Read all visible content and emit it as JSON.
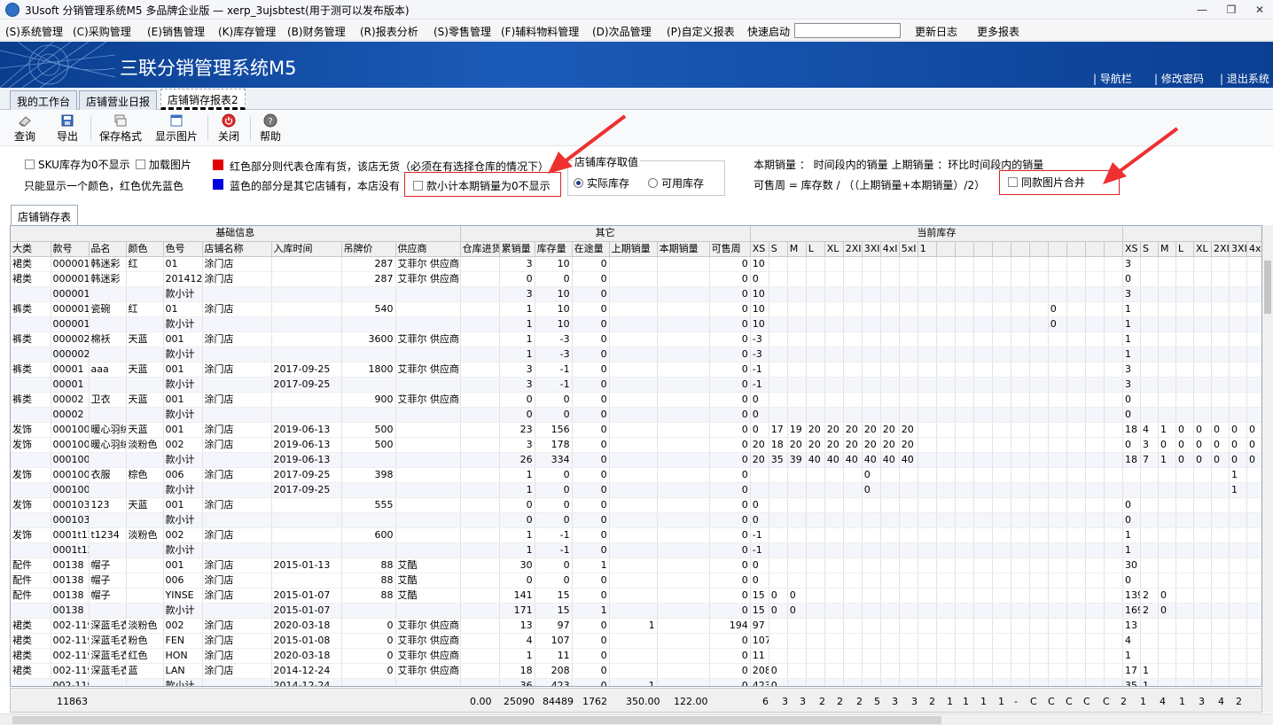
{
  "window": {
    "title": "3Usoft 分销管理系统M5 多品牌企业版 — xerp_3ujsbtest(用于测可以发布版本)"
  },
  "menu": {
    "items": [
      "(S)系统管理",
      "(C)采购管理",
      "(E)销售管理",
      "(K)库存管理",
      "(B)财务管理",
      "(R)报表分析",
      "(S)零售管理",
      "(F)辅料物料管理",
      "(D)次品管理",
      "(P)自定义报表"
    ],
    "quick_start": "快速启动",
    "search_value": "",
    "update_log": "更新日志",
    "more_reports": "更多报表"
  },
  "banner": {
    "title": "三联分销管理系统M5",
    "links": [
      "导航栏",
      "修改密码",
      "退出系统"
    ]
  },
  "tabs": [
    {
      "label": "我的工作台"
    },
    {
      "label": "店铺营业日报"
    },
    {
      "label": "店铺销存报表2"
    }
  ],
  "toolbar": {
    "query": "查询",
    "export": "导出",
    "save_format": "保存格式",
    "show_image": "显示图片",
    "close": "关闭",
    "help": "帮助"
  },
  "filters": {
    "sku_zero_hide": "SKU库存为0不显示",
    "load_image": "加载图片",
    "only_one_color": "只能显示一个颜色，红色优先蓝色",
    "red_note": "红色部分则代表仓库有货，该店无货（必须在有选择仓库的情况下）",
    "blue_note": "蓝色的部分是其它店铺有，本店没有",
    "subtotal_zero_hide": "款小计本期销量为0不显示",
    "stock_group": "店铺库存取值",
    "actual_stock": "实际库存",
    "available_stock": "可用库存",
    "sales_def": "本期销量 ： 时间段内的销量   上期销量 ：环比时间段内的销量",
    "weeks_def": "可售周 = 库存数 / （（上期销量+本期销量）/2）",
    "merge_same_image": "同款图片合并",
    "red_color": "#e00000",
    "blue_color": "#0000e0"
  },
  "subtab": "店铺销存表",
  "grid": {
    "groups": [
      {
        "label": "基础信息",
        "span": 9
      },
      {
        "label": "其它",
        "span": 7
      },
      {
        "label": "当前库存",
        "span": 20
      },
      {
        "label": "",
        "span": 8
      }
    ],
    "headers": [
      "大类",
      "款号",
      "品名",
      "颜色",
      "色号",
      "店铺名称",
      "入库时间",
      "吊牌价",
      "供应商",
      "仓库进货",
      "累销量",
      "库存量",
      "在途量",
      "上期销量",
      "本期销量",
      "可售周",
      "XS",
      "S",
      "M",
      "L",
      "XL",
      "2XI",
      "3XI",
      "4xI",
      "5xI",
      "1",
      "",
      "",
      "",
      "",
      "",
      "",
      "",
      "",
      "",
      "",
      "XS",
      "S",
      "M",
      "L",
      "XL",
      "2XI",
      "3XI",
      "4x1"
    ],
    "rows": [
      [
        "裙类",
        "000001",
        "韩迷彩",
        "红",
        "01",
        "涂门店",
        "",
        "287",
        "艾菲尔 供应商",
        "",
        "3",
        "10",
        "0",
        "",
        "",
        "0",
        "10",
        "",
        "",
        "",
        "",
        "",
        "",
        "",
        "",
        "",
        "",
        "",
        "",
        "",
        "",
        "",
        "",
        "",
        "",
        "",
        "3",
        "",
        "",
        "",
        "",
        "",
        "",
        ""
      ],
      [
        "裙类",
        "000001",
        "韩迷彩",
        "",
        "201412",
        "涂门店",
        "",
        "287",
        "艾菲尔 供应商",
        "",
        "0",
        "0",
        "0",
        "",
        "",
        "0",
        "0",
        "",
        "",
        "",
        "",
        "",
        "",
        "",
        "",
        "",
        "",
        "",
        "",
        "",
        "",
        "",
        "",
        "",
        "",
        "",
        "0",
        "",
        "",
        "",
        "",
        "",
        "",
        ""
      ],
      [
        "",
        "000001",
        "",
        "",
        "款小计",
        "",
        "",
        "",
        "",
        "",
        "3",
        "10",
        "0",
        "",
        "",
        "0",
        "10",
        "",
        "",
        "",
        "",
        "",
        "",
        "",
        "",
        "",
        "",
        "",
        "",
        "",
        "",
        "",
        "",
        "",
        "",
        "",
        "3",
        "",
        "",
        "",
        "",
        "",
        "",
        ""
      ],
      [
        "裤类",
        "000001",
        "瓷碗",
        "红",
        "01",
        "涂门店",
        "",
        "540",
        "",
        "",
        "1",
        "10",
        "0",
        "",
        "",
        "0",
        "10",
        "",
        "",
        "",
        "",
        "",
        "",
        "",
        "",
        "",
        "",
        "",
        "",
        "",
        "",
        "",
        "0",
        "",
        "",
        "",
        "1",
        "",
        "",
        "",
        "",
        "",
        "",
        ""
      ],
      [
        "",
        "000001",
        "",
        "",
        "款小计",
        "",
        "",
        "",
        "",
        "",
        "1",
        "10",
        "0",
        "",
        "",
        "0",
        "10",
        "",
        "",
        "",
        "",
        "",
        "",
        "",
        "",
        "",
        "",
        "",
        "",
        "",
        "",
        "",
        "0",
        "",
        "",
        "",
        "1",
        "",
        "",
        "",
        "",
        "",
        "",
        ""
      ],
      [
        "裤类",
        "000002",
        "棉袄",
        "天蓝",
        "001",
        "涂门店",
        "",
        "3600",
        "艾菲尔 供应商",
        "",
        "1",
        "-3",
        "0",
        "",
        "",
        "0",
        "-3",
        "",
        "",
        "",
        "",
        "",
        "",
        "",
        "",
        "",
        "",
        "",
        "",
        "",
        "",
        "",
        "",
        "",
        "",
        "",
        "1",
        "",
        "",
        "",
        "",
        "",
        "",
        ""
      ],
      [
        "",
        "000002",
        "",
        "",
        "款小计",
        "",
        "",
        "",
        "",
        "",
        "1",
        "-3",
        "0",
        "",
        "",
        "0",
        "-3",
        "",
        "",
        "",
        "",
        "",
        "",
        "",
        "",
        "",
        "",
        "",
        "",
        "",
        "",
        "",
        "",
        "",
        "",
        "",
        "1",
        "",
        "",
        "",
        "",
        "",
        "",
        ""
      ],
      [
        "裤类",
        "00001",
        "aaa",
        "天蓝",
        "001",
        "涂门店",
        "2017-09-25",
        "1800",
        "艾菲尔 供应商",
        "",
        "3",
        "-1",
        "0",
        "",
        "",
        "0",
        "-1",
        "",
        "",
        "",
        "",
        "",
        "",
        "",
        "",
        "",
        "",
        "",
        "",
        "",
        "",
        "",
        "",
        "",
        "",
        "",
        "3",
        "",
        "",
        "",
        "",
        "",
        "",
        ""
      ],
      [
        "",
        "00001",
        "",
        "",
        "款小计",
        "",
        "2017-09-25",
        "",
        "",
        "",
        "3",
        "-1",
        "0",
        "",
        "",
        "0",
        "-1",
        "",
        "",
        "",
        "",
        "",
        "",
        "",
        "",
        "",
        "",
        "",
        "",
        "",
        "",
        "",
        "",
        "",
        "",
        "",
        "3",
        "",
        "",
        "",
        "",
        "",
        "",
        ""
      ],
      [
        "裤类",
        "00002",
        "卫衣",
        "天蓝",
        "001",
        "涂门店",
        "",
        "900",
        "艾菲尔 供应商",
        "",
        "0",
        "0",
        "0",
        "",
        "",
        "0",
        "0",
        "",
        "",
        "",
        "",
        "",
        "",
        "",
        "",
        "",
        "",
        "",
        "",
        "",
        "",
        "",
        "",
        "",
        "",
        "",
        "0",
        "",
        "",
        "",
        "",
        "",
        "",
        ""
      ],
      [
        "",
        "00002",
        "",
        "",
        "款小计",
        "",
        "",
        "",
        "",
        "",
        "0",
        "0",
        "0",
        "",
        "",
        "0",
        "0",
        "",
        "",
        "",
        "",
        "",
        "",
        "",
        "",
        "",
        "",
        "",
        "",
        "",
        "",
        "",
        "",
        "",
        "",
        "",
        "0",
        "",
        "",
        "",
        "",
        "",
        "",
        ""
      ],
      [
        "发饰",
        "0001000",
        "暖心羽绒",
        "天蓝",
        "001",
        "涂门店",
        "2019-06-13",
        "500",
        "",
        "",
        "23",
        "156",
        "0",
        "",
        "",
        "0",
        "0",
        "17",
        "19",
        "20",
        "20",
        "20",
        "20",
        "20",
        "20",
        "",
        "",
        "",
        "",
        "",
        "",
        "",
        "",
        "",
        "",
        "",
        "18",
        "4",
        "1",
        "0",
        "0",
        "0",
        "0",
        "0"
      ],
      [
        "发饰",
        "0001000",
        "暖心羽绒",
        "淡粉色",
        "002",
        "涂门店",
        "2019-06-13",
        "500",
        "",
        "",
        "3",
        "178",
        "0",
        "",
        "",
        "0",
        "20",
        "18",
        "20",
        "20",
        "20",
        "20",
        "20",
        "20",
        "20",
        "",
        "",
        "",
        "",
        "",
        "",
        "",
        "",
        "",
        "",
        "",
        "0",
        "3",
        "0",
        "0",
        "0",
        "0",
        "0",
        "0"
      ],
      [
        "",
        "0001000",
        "",
        "",
        "款小计",
        "",
        "2019-06-13",
        "",
        "",
        "",
        "26",
        "334",
        "0",
        "",
        "",
        "0",
        "20",
        "35",
        "39",
        "40",
        "40",
        "40",
        "40",
        "40",
        "40",
        "",
        "",
        "",
        "",
        "",
        "",
        "",
        "",
        "",
        "",
        "",
        "18",
        "7",
        "1",
        "0",
        "0",
        "0",
        "0",
        "0"
      ],
      [
        "发饰",
        "0001000",
        "衣服",
        "棕色",
        "006",
        "涂门店",
        "2017-09-25",
        "398",
        "",
        "",
        "1",
        "0",
        "0",
        "",
        "",
        "0",
        "",
        "",
        "",
        "",
        "",
        "",
        "0",
        "",
        "",
        "",
        "",
        "",
        "",
        "",
        "",
        "",
        "",
        "",
        "",
        "",
        "",
        "",
        "",
        "",
        "",
        "",
        "1",
        ""
      ],
      [
        "",
        "0001000",
        "",
        "",
        "款小计",
        "",
        "2017-09-25",
        "",
        "",
        "",
        "1",
        "0",
        "0",
        "",
        "",
        "0",
        "",
        "",
        "",
        "",
        "",
        "",
        "0",
        "",
        "",
        "",
        "",
        "",
        "",
        "",
        "",
        "",
        "",
        "",
        "",
        "",
        "",
        "",
        "",
        "",
        "",
        "",
        "1",
        ""
      ],
      [
        "发饰",
        "0001030",
        "123",
        "天蓝",
        "001",
        "涂门店",
        "",
        "555",
        "",
        "",
        "0",
        "0",
        "0",
        "",
        "",
        "0",
        "0",
        "",
        "",
        "",
        "",
        "",
        "",
        "",
        "",
        "",
        "",
        "",
        "",
        "",
        "",
        "",
        "",
        "",
        "",
        "",
        "0",
        "",
        "",
        "",
        "",
        "",
        "",
        ""
      ],
      [
        "",
        "0001030",
        "",
        "",
        "款小计",
        "",
        "",
        "",
        "",
        "",
        "0",
        "0",
        "0",
        "",
        "",
        "0",
        "0",
        "",
        "",
        "",
        "",
        "",
        "",
        "",
        "",
        "",
        "",
        "",
        "",
        "",
        "",
        "",
        "",
        "",
        "",
        "",
        "0",
        "",
        "",
        "",
        "",
        "",
        "",
        ""
      ],
      [
        "发饰",
        "0001t12",
        "t1234",
        "淡粉色",
        "002",
        "涂门店",
        "",
        "600",
        "",
        "",
        "1",
        "-1",
        "0",
        "",
        "",
        "0",
        "-1",
        "",
        "",
        "",
        "",
        "",
        "",
        "",
        "",
        "",
        "",
        "",
        "",
        "",
        "",
        "",
        "",
        "",
        "",
        "",
        "1",
        "",
        "",
        "",
        "",
        "",
        "",
        ""
      ],
      [
        "",
        "0001t12",
        "",
        "",
        "款小计",
        "",
        "",
        "",
        "",
        "",
        "1",
        "-1",
        "0",
        "",
        "",
        "0",
        "-1",
        "",
        "",
        "",
        "",
        "",
        "",
        "",
        "",
        "",
        "",
        "",
        "",
        "",
        "",
        "",
        "",
        "",
        "",
        "",
        "1",
        "",
        "",
        "",
        "",
        "",
        "",
        ""
      ],
      [
        "配件",
        "00138",
        "帽子",
        "",
        "001",
        "涂门店",
        "2015-01-13",
        "88",
        "艾酷",
        "",
        "30",
        "0",
        "1",
        "",
        "",
        "0",
        "0",
        "",
        "",
        "",
        "",
        "",
        "",
        "",
        "",
        "",
        "",
        "",
        "",
        "",
        "",
        "",
        "",
        "",
        "",
        "",
        "30",
        "",
        "",
        "",
        "",
        "",
        "",
        ""
      ],
      [
        "配件",
        "00138",
        "帽子",
        "",
        "006",
        "涂门店",
        "",
        "88",
        "艾酷",
        "",
        "0",
        "0",
        "0",
        "",
        "",
        "0",
        "0",
        "",
        "",
        "",
        "",
        "",
        "",
        "",
        "",
        "",
        "",
        "",
        "",
        "",
        "",
        "",
        "",
        "",
        "",
        "",
        "0",
        "",
        "",
        "",
        "",
        "",
        "",
        ""
      ],
      [
        "配件",
        "00138",
        "帽子",
        "",
        "YINSE",
        "涂门店",
        "2015-01-07",
        "88",
        "艾酷",
        "",
        "141",
        "15",
        "0",
        "",
        "",
        "0",
        "15",
        "0",
        "0",
        "",
        "",
        "",
        "",
        "",
        "",
        "",
        "",
        "",
        "",
        "",
        "",
        "",
        "",
        "",
        "",
        "",
        "139",
        "2",
        "0",
        "",
        "",
        "",
        "",
        ""
      ],
      [
        "",
        "00138",
        "",
        "",
        "款小计",
        "",
        "2015-01-07",
        "",
        "",
        "",
        "171",
        "15",
        "1",
        "",
        "",
        "0",
        "15",
        "0",
        "0",
        "",
        "",
        "",
        "",
        "",
        "",
        "",
        "",
        "",
        "",
        "",
        "",
        "",
        "",
        "",
        "",
        "",
        "169",
        "2",
        "0",
        "",
        "",
        "",
        "",
        ""
      ],
      [
        "裙类",
        "002-119",
        "深蓝毛衣",
        "淡粉色",
        "002",
        "涂门店",
        "2020-03-18",
        "0",
        "艾菲尔 供应商",
        "",
        "13",
        "97",
        "0",
        "1",
        "",
        "194",
        "97",
        "",
        "",
        "",
        "",
        "",
        "",
        "",
        "",
        "",
        "",
        "",
        "",
        "",
        "",
        "",
        "",
        "",
        "",
        "",
        "13",
        "",
        "",
        "",
        "",
        "",
        "",
        ""
      ],
      [
        "裙类",
        "002-119",
        "深蓝毛衣",
        "粉色",
        "FEN",
        "涂门店",
        "2015-01-08",
        "0",
        "艾菲尔 供应商",
        "",
        "4",
        "107",
        "0",
        "",
        "",
        "0",
        "107",
        "",
        "",
        "",
        "",
        "",
        "",
        "",
        "",
        "",
        "",
        "",
        "",
        "",
        "",
        "",
        "",
        "",
        "",
        "",
        "4",
        "",
        "",
        "",
        "",
        "",
        "",
        ""
      ],
      [
        "裙类",
        "002-119",
        "深蓝毛衣",
        "红色",
        "HON",
        "涂门店",
        "2020-03-18",
        "0",
        "艾菲尔 供应商",
        "",
        "1",
        "11",
        "0",
        "",
        "",
        "0",
        "11",
        "",
        "",
        "",
        "",
        "",
        "",
        "",
        "",
        "",
        "",
        "",
        "",
        "",
        "",
        "",
        "",
        "",
        "",
        "",
        "1",
        "",
        "",
        "",
        "",
        "",
        "",
        ""
      ],
      [
        "裙类",
        "002-119",
        "深蓝毛衣",
        "蓝",
        "LAN",
        "涂门店",
        "2014-12-24",
        "0",
        "艾菲尔 供应商",
        "",
        "18",
        "208",
        "0",
        "",
        "",
        "0",
        "208",
        "0",
        "",
        "",
        "",
        "",
        "",
        "",
        "",
        "",
        "",
        "",
        "",
        "",
        "",
        "",
        "",
        "",
        "",
        "",
        "17",
        "1",
        "",
        "",
        "",
        "",
        "",
        ""
      ],
      [
        "",
        "002-119",
        "",
        "",
        "款小计",
        "",
        "2014-12-24",
        "",
        "",
        "",
        "36",
        "423",
        "0",
        "1",
        "",
        "0",
        "423",
        "0",
        "",
        "",
        "",
        "",
        "",
        "",
        "",
        "",
        "",
        "",
        "",
        "",
        "",
        "",
        "",
        "",
        "",
        "",
        "35",
        "1",
        "",
        "",
        "",
        "",
        "",
        ""
      ]
    ]
  },
  "totals": [
    "11863",
    "0.00",
    "25090",
    "84489",
    "1762",
    "350.00",
    "122.00",
    "6",
    "3",
    "3",
    "2",
    "2",
    "2",
    "5",
    "3",
    "3",
    "2",
    "1",
    "1",
    "1",
    "1",
    "-",
    "C",
    "C",
    "C",
    "C",
    "C",
    "2",
    "1",
    "4",
    "1",
    "3",
    "4",
    "2"
  ]
}
